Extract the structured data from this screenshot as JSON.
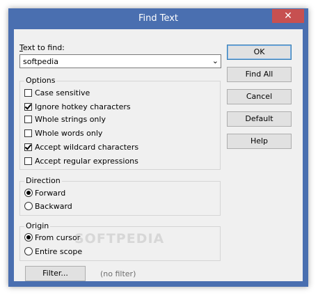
{
  "window": {
    "title": "Find Text",
    "close_glyph": "✕"
  },
  "find": {
    "label_prefix": "T",
    "label_rest": "ext to find:",
    "value": "softpedia",
    "arrow_glyph": "⌄"
  },
  "options": {
    "title": "Options",
    "items": [
      {
        "label": "Case sensitive",
        "checked": false
      },
      {
        "label": "Ignore hotkey characters",
        "checked": true
      },
      {
        "label": "Whole strings only",
        "checked": false
      },
      {
        "label": "Whole words only",
        "checked": false
      },
      {
        "label": "Accept wildcard characters",
        "checked": true
      },
      {
        "label": "Accept regular expressions",
        "checked": false
      }
    ]
  },
  "direction": {
    "title": "Direction",
    "items": [
      {
        "label": "Forward",
        "selected": true
      },
      {
        "label": "Backward",
        "selected": false
      }
    ]
  },
  "origin": {
    "title": "Origin",
    "items": [
      {
        "label": "From cursor",
        "selected": true
      },
      {
        "label": "Entire scope",
        "selected": false
      }
    ]
  },
  "buttons": {
    "ok": "OK",
    "find_all": "Find All",
    "cancel": "Cancel",
    "default": "Default",
    "help": "Help"
  },
  "filter": {
    "button_label": "Filter...",
    "status": "(no filter)"
  },
  "watermark": "SOFTPEDIA"
}
